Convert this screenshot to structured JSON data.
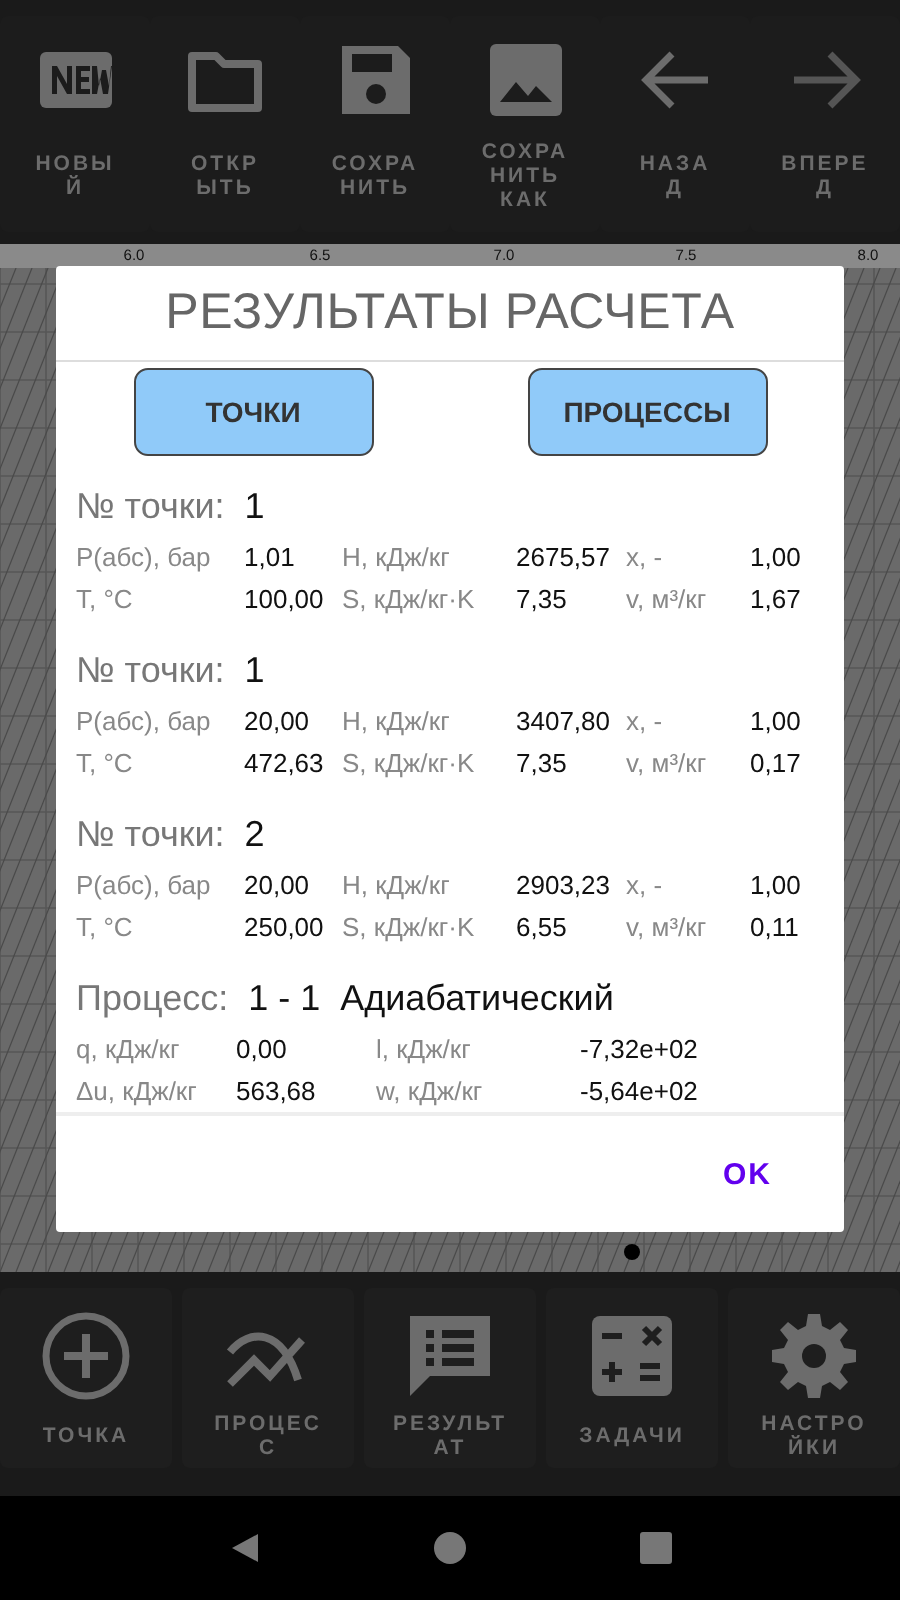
{
  "toolbar": [
    {
      "kind": "new",
      "label": "НОВЫ\nЙ"
    },
    {
      "kind": "folder",
      "label": "ОТКР\nЫТЬ"
    },
    {
      "kind": "save",
      "label": "СОХРА\nНИТЬ"
    },
    {
      "kind": "image",
      "label": "СОХРА\nНИТЬ\nКАК"
    },
    {
      "kind": "back",
      "label": "НАЗА\nД"
    },
    {
      "kind": "forward",
      "label": "ВПЕРЕ\nД"
    }
  ],
  "chart": {
    "x_tick_labels": [
      "6.0",
      "6.5",
      "7.0",
      "7.5",
      "8.0"
    ]
  },
  "dialog": {
    "title": "РЕЗУЛЬТАТЫ РАСЧЕТА",
    "tabs": [
      {
        "label": "ТОЧКИ"
      },
      {
        "label": "ПРОЦЕССЫ"
      }
    ],
    "points": [
      {
        "number_label": "№ точки:",
        "number": "1",
        "rows": [
          [
            "P(абс), бар",
            "1,01",
            "H, кДж/кг",
            "2675,57",
            "x, -",
            "1,00"
          ],
          [
            "T, °C",
            "100,00",
            "S, кДж/кг·K",
            "7,35",
            "v, м³/кг",
            "1,67"
          ]
        ]
      },
      {
        "number_label": "№ точки:",
        "number": "1",
        "rows": [
          [
            "P(абс), бар",
            "20,00",
            "H, кДж/кг",
            "3407,80",
            "x, -",
            "1,00"
          ],
          [
            "T, °C",
            "472,63",
            "S, кДж/кг·K",
            "7,35",
            "v, м³/кг",
            "0,17"
          ]
        ]
      },
      {
        "number_label": "№ точки:",
        "number": "2",
        "rows": [
          [
            "P(абс), бар",
            "20,00",
            "H, кДж/кг",
            "2903,23",
            "x, -",
            "1,00"
          ],
          [
            "T, °C",
            "250,00",
            "S, кДж/кг·K",
            "6,55",
            "v, м³/кг",
            "0,11"
          ]
        ]
      }
    ],
    "process": {
      "label": "Процесс:",
      "number": "1 - 1",
      "type": "Адиабатический",
      "rows": [
        [
          "q, кДж/кг",
          "0,00",
          "l, кДж/кг",
          "-7,32e+02"
        ],
        [
          "Δu, кДж/кг",
          "563,68",
          "w, кДж/кг",
          "-5,64e+02"
        ]
      ]
    },
    "ok_button": "OK"
  },
  "bottom_bar": [
    {
      "kind": "add",
      "label": "ТОЧКА"
    },
    {
      "kind": "process",
      "label": "ПРОЦЕС\nС"
    },
    {
      "kind": "results",
      "label": "РЕЗУЛЬТ\nАТ"
    },
    {
      "kind": "calc",
      "label": "ЗАДАЧИ"
    },
    {
      "kind": "gear",
      "label": "НАСТРО\nЙКИ"
    }
  ]
}
